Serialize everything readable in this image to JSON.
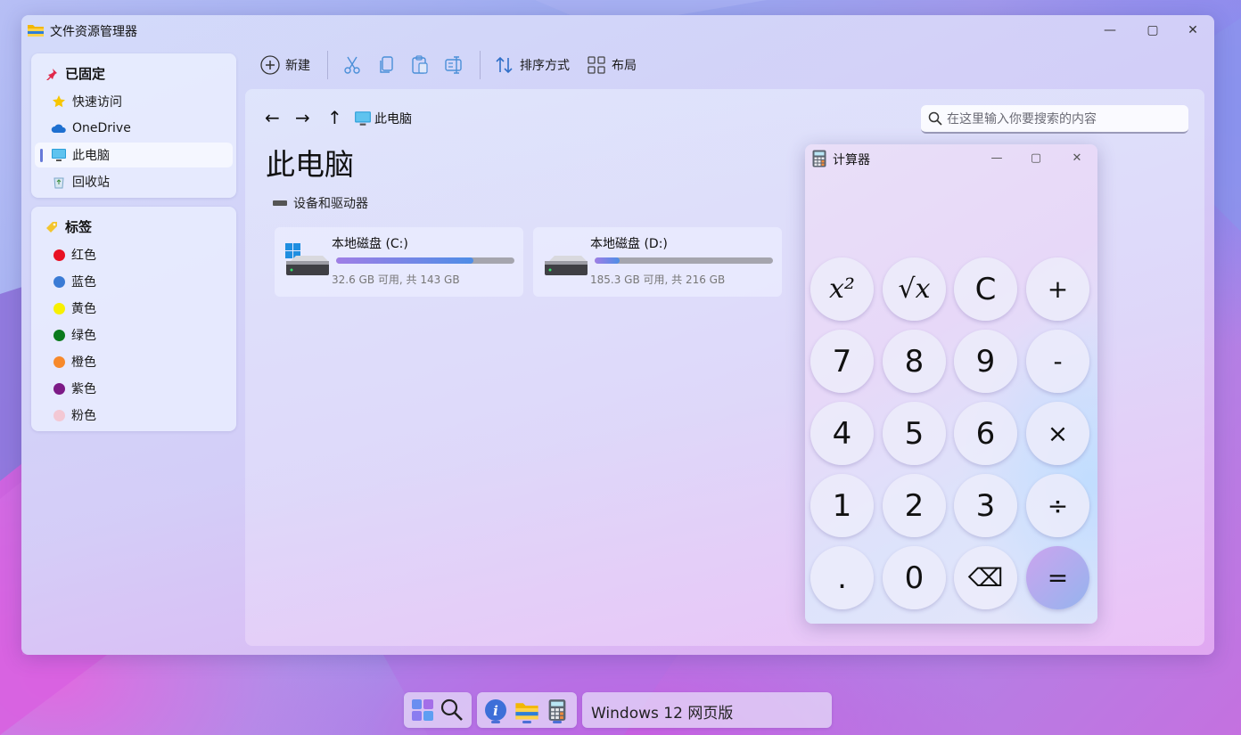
{
  "explorer": {
    "title": "文件资源管理器",
    "window_controls": [
      "—",
      "▢",
      "✕"
    ],
    "sidebar": {
      "pinned_header": "已固定",
      "pinned_items": [
        {
          "label": "快速访问",
          "icon": "star-icon"
        },
        {
          "label": "OneDrive",
          "icon": "cloud-icon"
        },
        {
          "label": "此电脑",
          "icon": "monitor-icon",
          "active": true
        },
        {
          "label": "回收站",
          "icon": "recycle-bin-icon"
        }
      ],
      "tags_header": "标签",
      "tags": [
        {
          "label": "红色",
          "color": "#e81123"
        },
        {
          "label": "蓝色",
          "color": "#3a7bd5"
        },
        {
          "label": "黄色",
          "color": "#f7f000"
        },
        {
          "label": "绿色",
          "color": "#0b7a1d"
        },
        {
          "label": "橙色",
          "color": "#f7892b"
        },
        {
          "label": "紫色",
          "color": "#7c1a86"
        },
        {
          "label": "粉色",
          "color": "#f3c8d4"
        }
      ]
    },
    "toolbar": {
      "new_label": "新建",
      "sort_label": "排序方式",
      "layout_label": "布局"
    },
    "nav": {
      "back": "←",
      "forward": "→",
      "up": "↑",
      "breadcrumb": "此电脑"
    },
    "search": {
      "placeholder": "在这里输入你要搜索的内容"
    },
    "page_title": "此电脑",
    "section_label": "设备和驱动器",
    "drives": [
      {
        "name": "本地磁盘 (C:)",
        "free_text": "32.6 GB 可用, 共 143 GB",
        "used_fraction": 0.77,
        "system": true
      },
      {
        "name": "本地磁盘 (D:)",
        "free_text": "185.3 GB 可用, 共 216 GB",
        "used_fraction": 0.14,
        "system": false
      }
    ]
  },
  "calculator": {
    "title": "计算器",
    "window_controls": [
      "—",
      "▢",
      "✕"
    ],
    "keys": [
      [
        "x²",
        "√x",
        "C",
        "+"
      ],
      [
        "7",
        "8",
        "9",
        "-"
      ],
      [
        "4",
        "5",
        "6",
        "×"
      ],
      [
        "1",
        "2",
        "3",
        "÷"
      ],
      [
        ".",
        "0",
        "⌫",
        "="
      ]
    ]
  },
  "taskbar": {
    "start_group": [
      "windows-start-icon",
      "search-icon"
    ],
    "apps": [
      "info-icon",
      "file-explorer-icon",
      "calculator-icon"
    ],
    "label": "Windows 12 网页版"
  }
}
